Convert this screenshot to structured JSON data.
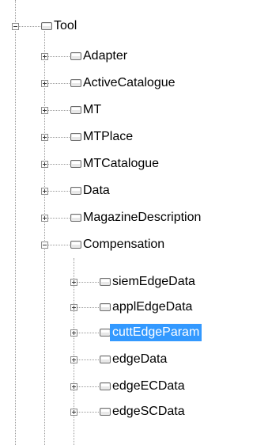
{
  "tree": {
    "root": {
      "label": "Tool",
      "expanded": true,
      "children": [
        {
          "label": "Adapter",
          "expanded": false
        },
        {
          "label": "ActiveCatalogue",
          "expanded": false
        },
        {
          "label": "MT",
          "expanded": false
        },
        {
          "label": "MTPlace",
          "expanded": false
        },
        {
          "label": "MTCatalogue",
          "expanded": false
        },
        {
          "label": "Data",
          "expanded": false
        },
        {
          "label": "MagazineDescription",
          "expanded": false
        },
        {
          "label": "Compensation",
          "expanded": true,
          "children": [
            {
              "label": "siemEdgeData",
              "expanded": false,
              "selected": false
            },
            {
              "label": "applEdgeData",
              "expanded": false,
              "selected": false
            },
            {
              "label": "cuttEdgeParam",
              "expanded": false,
              "selected": true
            },
            {
              "label": "edgeData",
              "expanded": false,
              "selected": false
            },
            {
              "label": "edgeECData",
              "expanded": false,
              "selected": false
            },
            {
              "label": "edgeSCData",
              "expanded": false,
              "selected": false
            }
          ]
        }
      ]
    }
  },
  "colors": {
    "selection": "#3399ff",
    "dotted_line": "#9a9a9a"
  },
  "icons": {
    "node": "folder-node-icon",
    "expand": "plus-box-icon",
    "collapse": "minus-box-icon"
  }
}
